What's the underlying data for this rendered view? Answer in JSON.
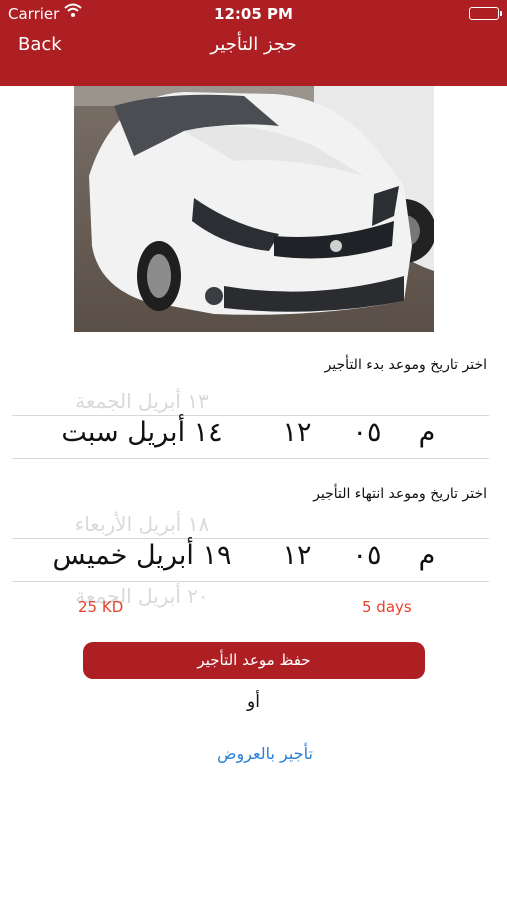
{
  "status_bar": {
    "carrier": "Carrier",
    "time": "12:05 PM"
  },
  "nav": {
    "back_label": "Back",
    "title": "حجز التأجير"
  },
  "start": {
    "label": "اختر تاريخ وموعد بدء التأجير",
    "selected": {
      "date": "١٤ أبريل سبت",
      "hour": "١٢",
      "minute": "٠٥",
      "ampm": "م"
    },
    "above_text": "١٣ أبريل الجمعة"
  },
  "end": {
    "label": "اختر تاريخ وموعد انتهاء التأجير",
    "selected": {
      "date": "١٩ أبريل خميس",
      "hour": "١٢",
      "minute": "٠٥",
      "ampm": "م"
    },
    "above_text": "١٨ أبريل الأربعاء",
    "below_text": "٢٠ أبريل الجمعة"
  },
  "summary": {
    "price": "25 KD",
    "days": "5 days"
  },
  "save_button": "حفظ موعد التأجير",
  "or_text": "أو",
  "offers_link": "تأجير بالعروض",
  "colors": {
    "brand": "#ae1f24",
    "accent": "#e8422a",
    "link": "#2a7fd6"
  },
  "icons": [
    "wifi-icon",
    "battery-icon",
    "car-photo"
  ]
}
